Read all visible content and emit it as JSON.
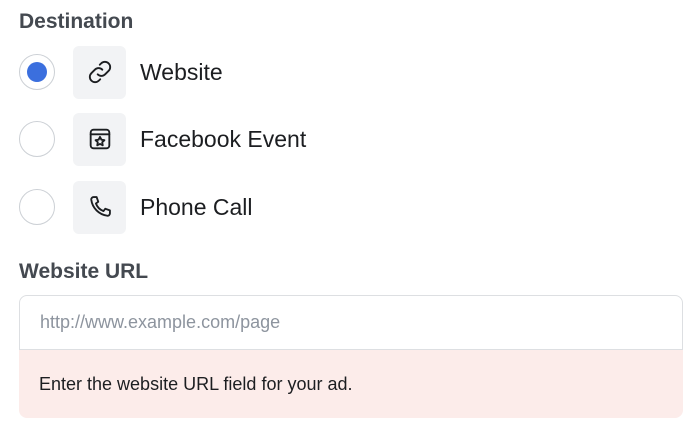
{
  "destination": {
    "title": "Destination",
    "options": [
      {
        "label": "Website",
        "icon": "link-icon",
        "selected": true
      },
      {
        "label": "Facebook Event",
        "icon": "calendar-star-icon",
        "selected": false
      },
      {
        "label": "Phone Call",
        "icon": "phone-icon",
        "selected": false
      }
    ]
  },
  "website_url": {
    "title": "Website URL",
    "placeholder": "http://www.example.com/page",
    "value": "",
    "error": "Enter the website URL field for your ad."
  },
  "colors": {
    "radio_selected": "#3b6fde",
    "error_background": "#fcecea"
  }
}
